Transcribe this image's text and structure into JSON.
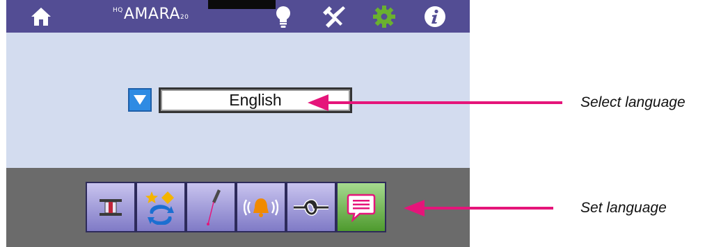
{
  "app": {
    "logo_text": "AMARA",
    "logo_prefix": "HQ",
    "logo_version": "20"
  },
  "topbar": {
    "icons": [
      "home-icon",
      "lightbulb-icon",
      "tools-icon",
      "settings-gear-icon",
      "info-icon"
    ]
  },
  "language": {
    "selected_value": "English"
  },
  "toolbar": {
    "buttons": [
      "bobbin-icon",
      "stars-rotate-icon",
      "needle-laser-icon",
      "alarm-bell-icon",
      "knot-icon",
      "speech-bubble-icon"
    ],
    "active": "speech-bubble-icon"
  },
  "annotations": {
    "select_language": "Select language",
    "set_language": "Set language"
  },
  "colors": {
    "topbar": "#534d94",
    "screen_bg": "#d3dcef",
    "bottombar": "#6b6b6b",
    "accent_blue": "#2e8be3",
    "active_green": "#5aa23a",
    "gear_green": "#6ab12f",
    "arrow_magenta": "#e5157a"
  }
}
